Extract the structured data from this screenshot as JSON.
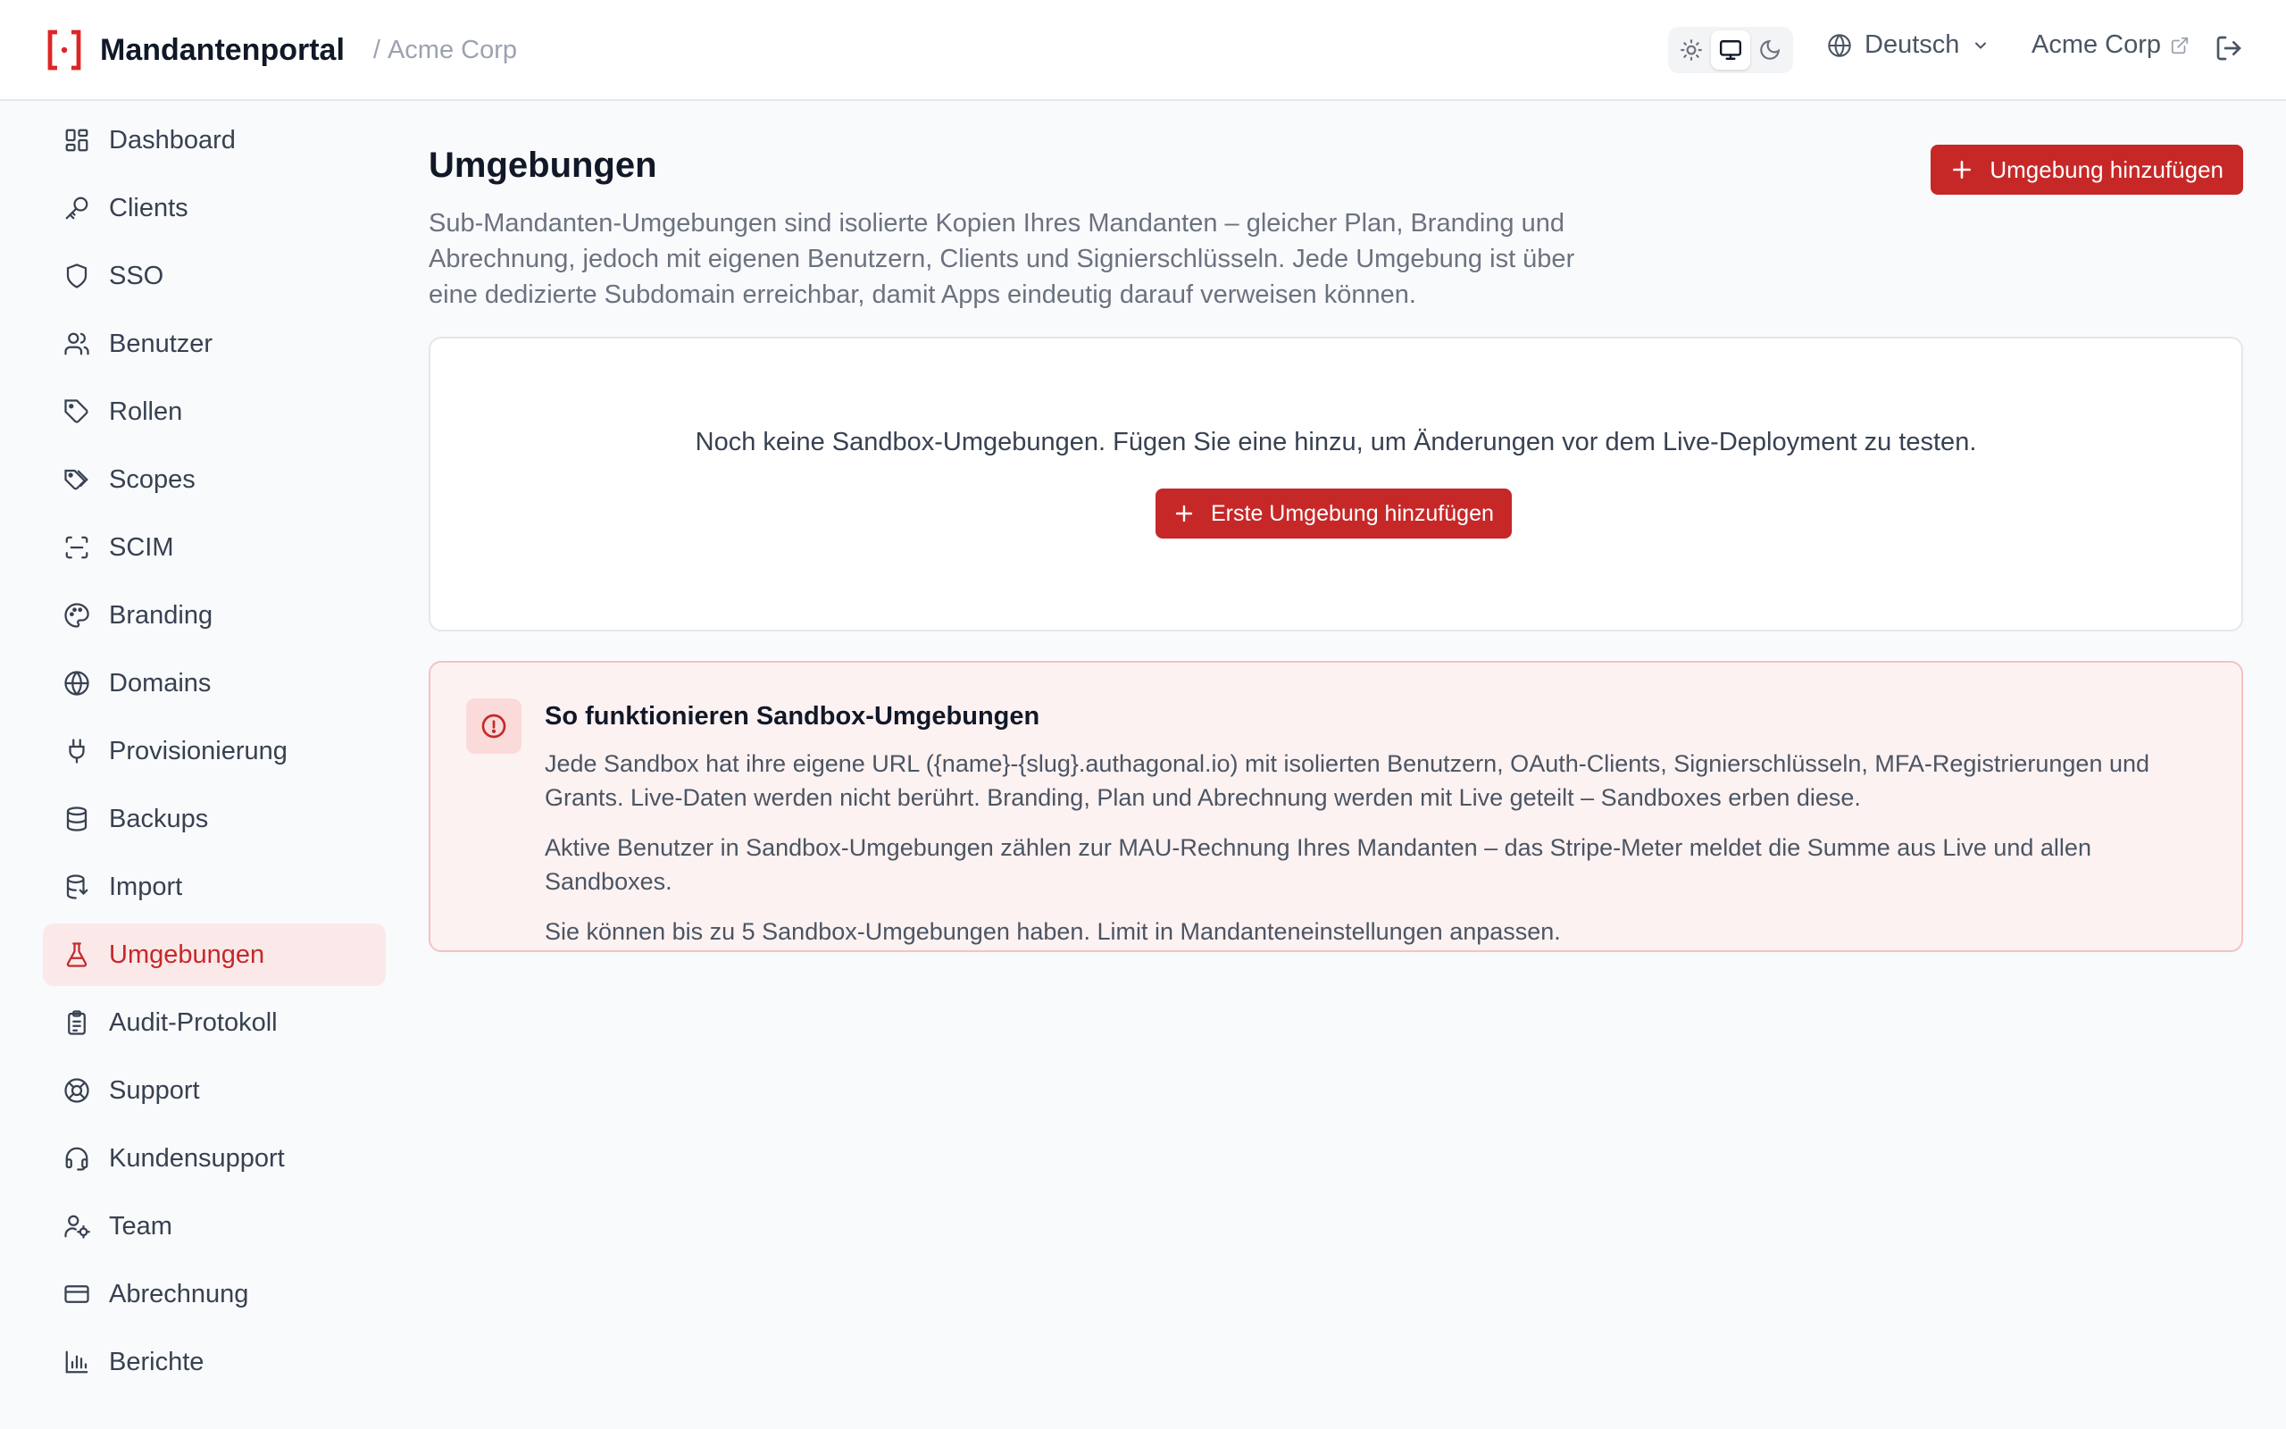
{
  "header": {
    "app_title": "Mandantenportal",
    "separator": "/",
    "tenant_name": "Acme Corp",
    "theme_modes": [
      "light-icon",
      "monitor-icon",
      "moon-icon"
    ],
    "theme_active": "monitor-icon",
    "language": "Deutsch",
    "tenant_link": "Acme Corp"
  },
  "sidebar": {
    "items": [
      {
        "label": "Dashboard",
        "icon": "dashboard-icon"
      },
      {
        "label": "Clients",
        "icon": "key-icon"
      },
      {
        "label": "SSO",
        "icon": "shield-icon"
      },
      {
        "label": "Benutzer",
        "icon": "users-icon"
      },
      {
        "label": "Rollen",
        "icon": "tag-icon"
      },
      {
        "label": "Scopes",
        "icon": "tags-icon"
      },
      {
        "label": "SCIM",
        "icon": "scan-icon"
      },
      {
        "label": "Branding",
        "icon": "palette-icon"
      },
      {
        "label": "Domains",
        "icon": "globe-icon"
      },
      {
        "label": "Provisionierung",
        "icon": "plug-icon"
      },
      {
        "label": "Backups",
        "icon": "database-icon"
      },
      {
        "label": "Import",
        "icon": "database-import-icon"
      },
      {
        "label": "Umgebungen",
        "icon": "flask-icon",
        "active": true
      },
      {
        "label": "Audit-Protokoll",
        "icon": "clipboard-icon"
      },
      {
        "label": "Support",
        "icon": "lifebuoy-icon"
      },
      {
        "label": "Kundensupport",
        "icon": "headset-icon"
      },
      {
        "label": "Team",
        "icon": "user-cog-icon"
      },
      {
        "label": "Abrechnung",
        "icon": "credit-card-icon"
      },
      {
        "label": "Berichte",
        "icon": "bar-chart-icon"
      }
    ]
  },
  "main": {
    "title": "Umgebungen",
    "description": "Sub-Mandanten-Umgebungen sind isolierte Kopien Ihres Mandanten – gleicher Plan, Branding und Abrechnung, jedoch mit eigenen Benutzern, Clients und Signierschlüsseln. Jede Umgebung ist über eine dedizierte Subdomain erreichbar, damit Apps eindeutig darauf verweisen können.",
    "add_button": "Umgebung hinzufügen",
    "empty_state": {
      "text": "Noch keine Sandbox-Umgebungen. Fügen Sie eine hinzu, um Änderungen vor dem Live-Deployment zu testen.",
      "button": "Erste Umgebung hinzufügen"
    },
    "info": {
      "title": "So funktionieren Sandbox-Umgebungen",
      "paragraphs": [
        "Jede Sandbox hat ihre eigene URL ({name}-{slug}.authagonal.io) mit isolierten Benutzern, OAuth-Clients, Signierschlüsseln, MFA-Registrierungen und Grants. Live-Daten werden nicht berührt. Branding, Plan und Abrechnung werden mit Live geteilt – Sandboxes erben diese.",
        "Aktive Benutzer in Sandbox-Umgebungen zählen zur MAU-Rechnung Ihres Mandanten – das Stripe-Meter meldet die Summe aus Live und allen Sandboxes.",
        "Sie können bis zu 5 Sandbox-Umgebungen haben. Limit in Mandanteneinstellungen anpassen."
      ]
    }
  },
  "colors": {
    "accent": "#c62828",
    "active_bg": "#fbe9ea",
    "info_bg": "#fdf2f2",
    "info_border": "#f5c2c2"
  }
}
